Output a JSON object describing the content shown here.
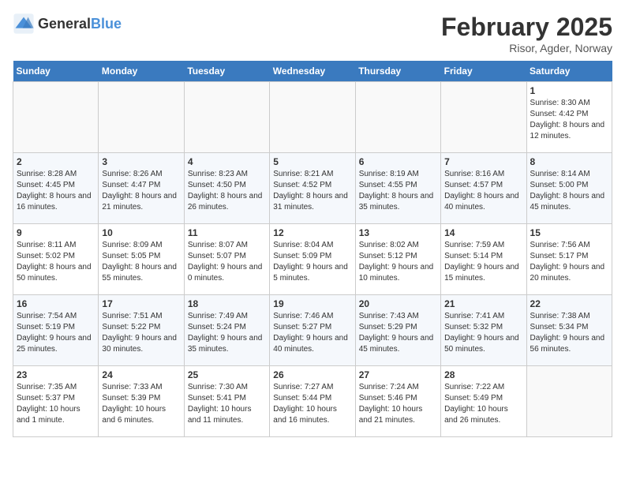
{
  "logo": {
    "text_general": "General",
    "text_blue": "Blue"
  },
  "title": "February 2025",
  "location": "Risor, Agder, Norway",
  "weekdays": [
    "Sunday",
    "Monday",
    "Tuesday",
    "Wednesday",
    "Thursday",
    "Friday",
    "Saturday"
  ],
  "weeks": [
    [
      {
        "day": "",
        "info": ""
      },
      {
        "day": "",
        "info": ""
      },
      {
        "day": "",
        "info": ""
      },
      {
        "day": "",
        "info": ""
      },
      {
        "day": "",
        "info": ""
      },
      {
        "day": "",
        "info": ""
      },
      {
        "day": "1",
        "info": "Sunrise: 8:30 AM\nSunset: 4:42 PM\nDaylight: 8 hours and 12 minutes."
      }
    ],
    [
      {
        "day": "2",
        "info": "Sunrise: 8:28 AM\nSunset: 4:45 PM\nDaylight: 8 hours and 16 minutes."
      },
      {
        "day": "3",
        "info": "Sunrise: 8:26 AM\nSunset: 4:47 PM\nDaylight: 8 hours and 21 minutes."
      },
      {
        "day": "4",
        "info": "Sunrise: 8:23 AM\nSunset: 4:50 PM\nDaylight: 8 hours and 26 minutes."
      },
      {
        "day": "5",
        "info": "Sunrise: 8:21 AM\nSunset: 4:52 PM\nDaylight: 8 hours and 31 minutes."
      },
      {
        "day": "6",
        "info": "Sunrise: 8:19 AM\nSunset: 4:55 PM\nDaylight: 8 hours and 35 minutes."
      },
      {
        "day": "7",
        "info": "Sunrise: 8:16 AM\nSunset: 4:57 PM\nDaylight: 8 hours and 40 minutes."
      },
      {
        "day": "8",
        "info": "Sunrise: 8:14 AM\nSunset: 5:00 PM\nDaylight: 8 hours and 45 minutes."
      }
    ],
    [
      {
        "day": "9",
        "info": "Sunrise: 8:11 AM\nSunset: 5:02 PM\nDaylight: 8 hours and 50 minutes."
      },
      {
        "day": "10",
        "info": "Sunrise: 8:09 AM\nSunset: 5:05 PM\nDaylight: 8 hours and 55 minutes."
      },
      {
        "day": "11",
        "info": "Sunrise: 8:07 AM\nSunset: 5:07 PM\nDaylight: 9 hours and 0 minutes."
      },
      {
        "day": "12",
        "info": "Sunrise: 8:04 AM\nSunset: 5:09 PM\nDaylight: 9 hours and 5 minutes."
      },
      {
        "day": "13",
        "info": "Sunrise: 8:02 AM\nSunset: 5:12 PM\nDaylight: 9 hours and 10 minutes."
      },
      {
        "day": "14",
        "info": "Sunrise: 7:59 AM\nSunset: 5:14 PM\nDaylight: 9 hours and 15 minutes."
      },
      {
        "day": "15",
        "info": "Sunrise: 7:56 AM\nSunset: 5:17 PM\nDaylight: 9 hours and 20 minutes."
      }
    ],
    [
      {
        "day": "16",
        "info": "Sunrise: 7:54 AM\nSunset: 5:19 PM\nDaylight: 9 hours and 25 minutes."
      },
      {
        "day": "17",
        "info": "Sunrise: 7:51 AM\nSunset: 5:22 PM\nDaylight: 9 hours and 30 minutes."
      },
      {
        "day": "18",
        "info": "Sunrise: 7:49 AM\nSunset: 5:24 PM\nDaylight: 9 hours and 35 minutes."
      },
      {
        "day": "19",
        "info": "Sunrise: 7:46 AM\nSunset: 5:27 PM\nDaylight: 9 hours and 40 minutes."
      },
      {
        "day": "20",
        "info": "Sunrise: 7:43 AM\nSunset: 5:29 PM\nDaylight: 9 hours and 45 minutes."
      },
      {
        "day": "21",
        "info": "Sunrise: 7:41 AM\nSunset: 5:32 PM\nDaylight: 9 hours and 50 minutes."
      },
      {
        "day": "22",
        "info": "Sunrise: 7:38 AM\nSunset: 5:34 PM\nDaylight: 9 hours and 56 minutes."
      }
    ],
    [
      {
        "day": "23",
        "info": "Sunrise: 7:35 AM\nSunset: 5:37 PM\nDaylight: 10 hours and 1 minute."
      },
      {
        "day": "24",
        "info": "Sunrise: 7:33 AM\nSunset: 5:39 PM\nDaylight: 10 hours and 6 minutes."
      },
      {
        "day": "25",
        "info": "Sunrise: 7:30 AM\nSunset: 5:41 PM\nDaylight: 10 hours and 11 minutes."
      },
      {
        "day": "26",
        "info": "Sunrise: 7:27 AM\nSunset: 5:44 PM\nDaylight: 10 hours and 16 minutes."
      },
      {
        "day": "27",
        "info": "Sunrise: 7:24 AM\nSunset: 5:46 PM\nDaylight: 10 hours and 21 minutes."
      },
      {
        "day": "28",
        "info": "Sunrise: 7:22 AM\nSunset: 5:49 PM\nDaylight: 10 hours and 26 minutes."
      },
      {
        "day": "",
        "info": ""
      }
    ]
  ]
}
